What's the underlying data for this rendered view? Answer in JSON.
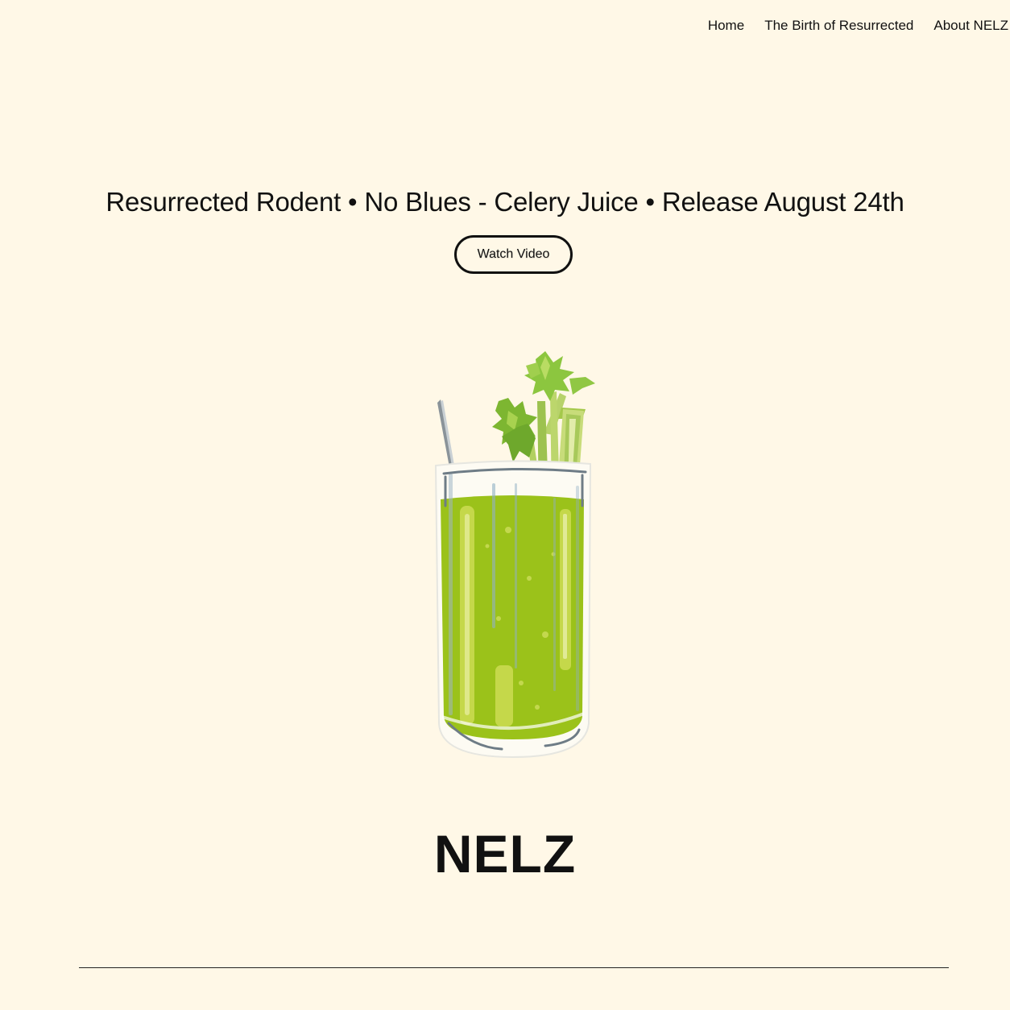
{
  "nav": {
    "items": [
      {
        "label": "Home"
      },
      {
        "label": "The Birth of Resurrected"
      },
      {
        "label": "About NELZ"
      }
    ]
  },
  "hero": {
    "headline": "Resurrected Rodent • No Blues - Celery Juice • Release August 24th",
    "button_label": "Watch Video",
    "illustration_icon": "celery-juice-glass-icon"
  },
  "site": {
    "title": "NELZ"
  },
  "colors": {
    "background": "#fff8e7",
    "text": "#111111",
    "juice": "#9bc21a",
    "juice_light": "#c5d84a",
    "celery_leaf": "#8cc63f",
    "straw": "#8a9399"
  }
}
